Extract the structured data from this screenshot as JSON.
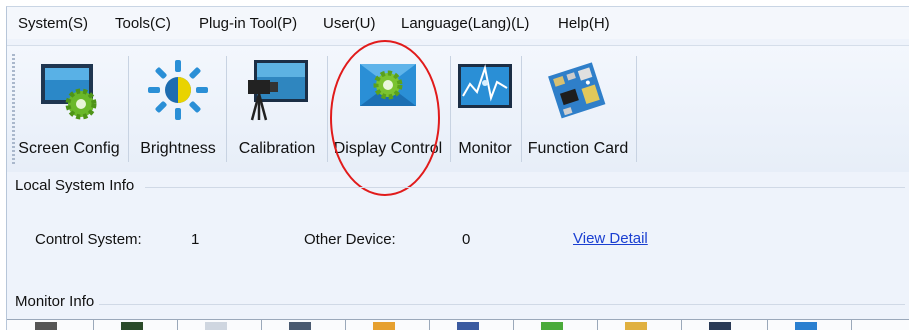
{
  "menu": [
    "System(S)",
    "Tools(C)",
    "Plug-in Tool(P)",
    "User(U)",
    "Language(Lang)(L)",
    "Help(H)"
  ],
  "toolbar": {
    "screen_config": "Screen Config",
    "brightness": "Brightness",
    "calibration": "Calibration",
    "display_control": "Display Control",
    "monitor": "Monitor",
    "function_card": "Function Card"
  },
  "local_system_info": {
    "title": "Local System Info",
    "control_system_label": "Control System:",
    "control_system_value": "1",
    "other_device_label": "Other Device:",
    "other_device_value": "0",
    "view_detail": "View Detail"
  },
  "monitor_info": {
    "title": "Monitor Info"
  },
  "colors": {
    "highlight_ring": "#e11b1b",
    "link": "#1a3fd1",
    "toolbar_bg": "#eef3fb"
  },
  "icons": [
    "screen-config-icon",
    "brightness-icon",
    "calibration-icon",
    "display-control-icon",
    "monitor-icon",
    "function-card-icon"
  ]
}
